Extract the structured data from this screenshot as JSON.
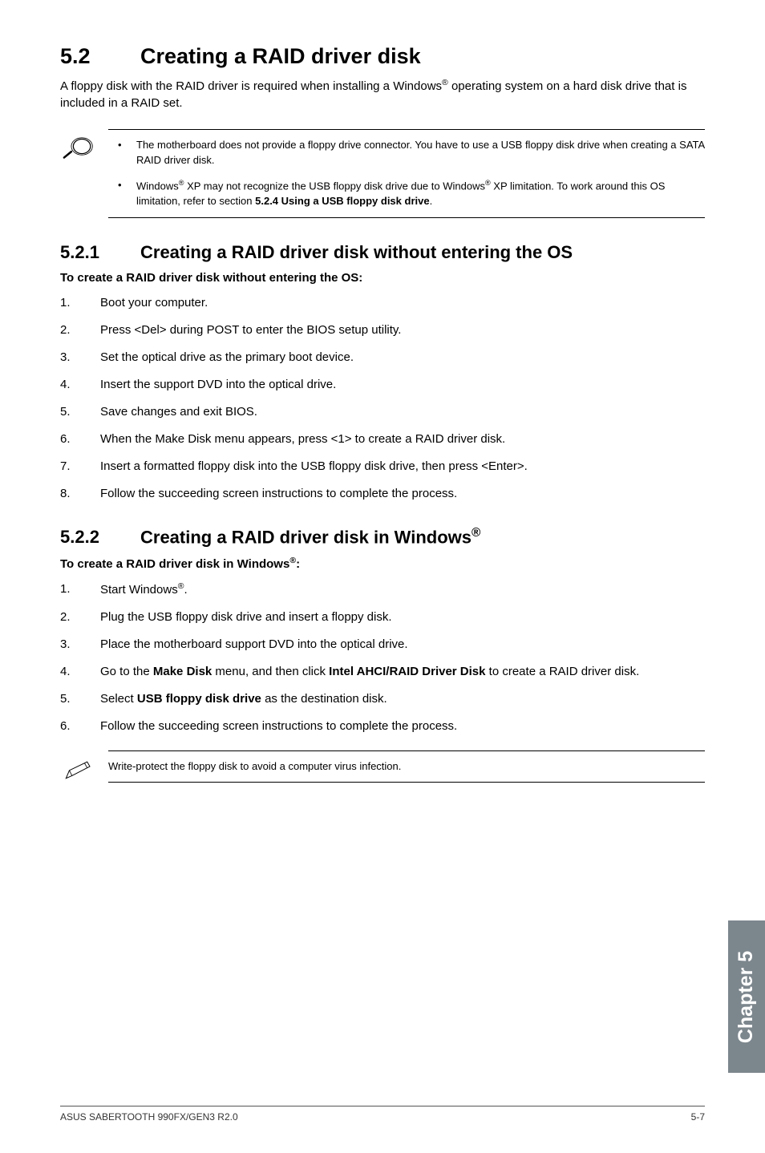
{
  "section": {
    "number": "5.2",
    "title": "Creating a RAID driver disk",
    "intro_a": "A floppy disk with the RAID driver is required when installing a Windows",
    "intro_b": " operating system on a hard disk drive that is included in a RAID set."
  },
  "note1": {
    "items": [
      {
        "lead": "",
        "text_a": "The motherboard does not provide a floppy drive connector. You have to use a USB ",
        "text_b": "floppy disk drive when creating a SATA RAID driver disk."
      },
      {
        "lead": "Windows",
        "text_a": " XP may not recognize the USB floppy disk drive due to Windows",
        "text_b": " XP limitation. To work around this OS limitation, refer to section ",
        "bold": "5.2.4 Using a USB floppy disk drive",
        "tail": "."
      }
    ]
  },
  "s521": {
    "number": "5.2.1",
    "title": "Creating a RAID driver disk without entering the OS",
    "subhead": "To create a RAID driver disk without entering the OS:",
    "steps": [
      "Boot your computer.",
      "Press <Del> during POST to enter the BIOS setup utility.",
      "Set the optical drive as the primary boot device.",
      "Insert the support DVD into the optical drive.",
      "Save changes and exit BIOS.",
      "When the Make Disk menu appears, press <1> to create a RAID driver disk.",
      "Insert a formatted floppy disk into the USB floppy disk drive, then press <Enter>.",
      "Follow the succeeding screen instructions to complete the process."
    ]
  },
  "s522": {
    "number": "5.2.2",
    "title_a": "Creating a RAID driver disk in Windows",
    "subhead_a": "To create a RAID driver disk in Windows",
    "subhead_b": ":",
    "steps": {
      "1a": "Start Windows",
      "1b": ".",
      "2": "Plug the USB floppy disk drive and insert a floppy disk.",
      "3": "Place the motherboard support DVD into the optical drive.",
      "4a": "Go to the ",
      "4b": "Make Disk",
      "4c": " menu, and then click ",
      "4d": "Intel AHCI/RAID Driver Disk",
      "4e": " to create a RAID driver disk.",
      "5a": "Select ",
      "5b": "USB floppy disk drive",
      "5c": " as the destination disk.",
      "6": "Follow the succeeding screen instructions to complete the process."
    }
  },
  "note2": {
    "text": "Write-protect the floppy disk to avoid a computer virus infection."
  },
  "chapter_tab": "Chapter 5",
  "footer": {
    "left": "ASUS SABERTOOTH 990FX/GEN3 R2.0",
    "right": "5-7"
  }
}
